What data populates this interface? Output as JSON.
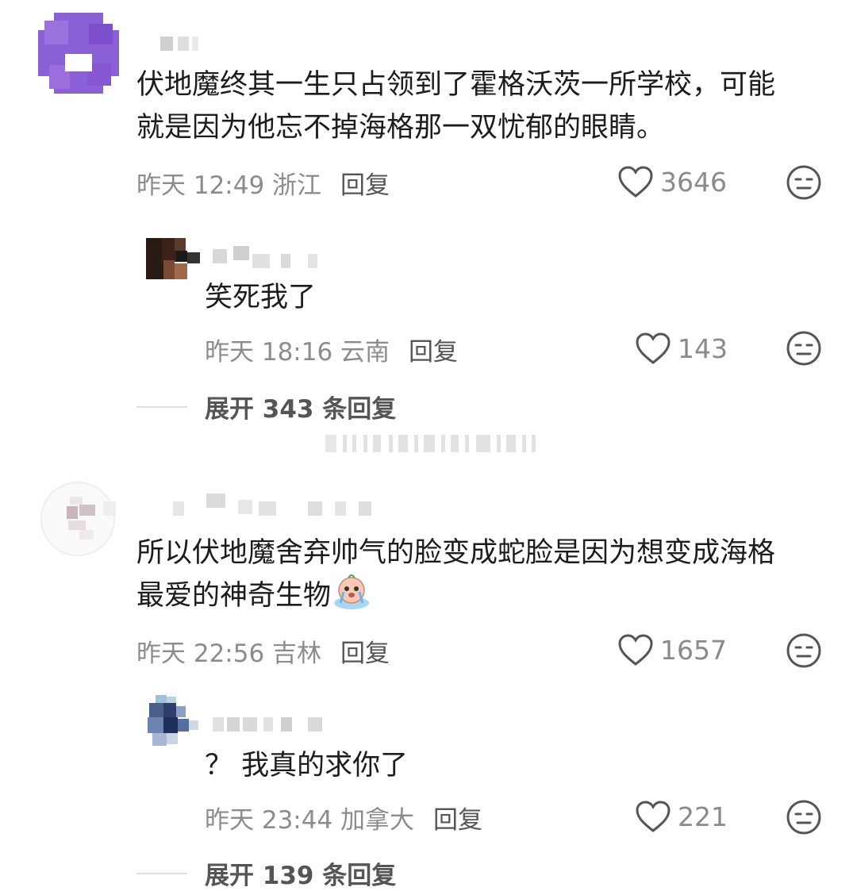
{
  "comments": [
    {
      "text_line1": "伏地魔终其一生只占领到了霍格沃茨一所学校，可能",
      "text_line2": "就是因为他忘不掉海格那一双忧郁的眼睛。",
      "time": "昨天 12:49 浙江",
      "reply_label": "回复",
      "likes": "3646",
      "replies": [
        {
          "text": "笑死我了",
          "time": "昨天 18:16 云南",
          "reply_label": "回复",
          "likes": "143"
        }
      ],
      "expand_label": "展开 343 条回复"
    },
    {
      "text_line1": "所以伏地魔舍弃帅气的脸变成蛇脸是因为想变成海格",
      "text_line2": "最爱的神奇生物",
      "time": "昨天 22:56 吉林",
      "reply_label": "回复",
      "likes": "1657",
      "replies": [
        {
          "text": "？ 我真的求你了",
          "time": "昨天 23:44 加拿大",
          "reply_label": "回复",
          "likes": "221"
        }
      ],
      "expand_label": "展开 139 条回复"
    }
  ],
  "icons": {
    "like": "heart-outline-icon",
    "dislike": "neutral-face-icon",
    "emoji": "crying-emoji"
  },
  "colors": {
    "text": "#1c1c1c",
    "meta": "#8c8c8c",
    "reply": "#555555",
    "avatar_purple": "#8b5fd6"
  }
}
